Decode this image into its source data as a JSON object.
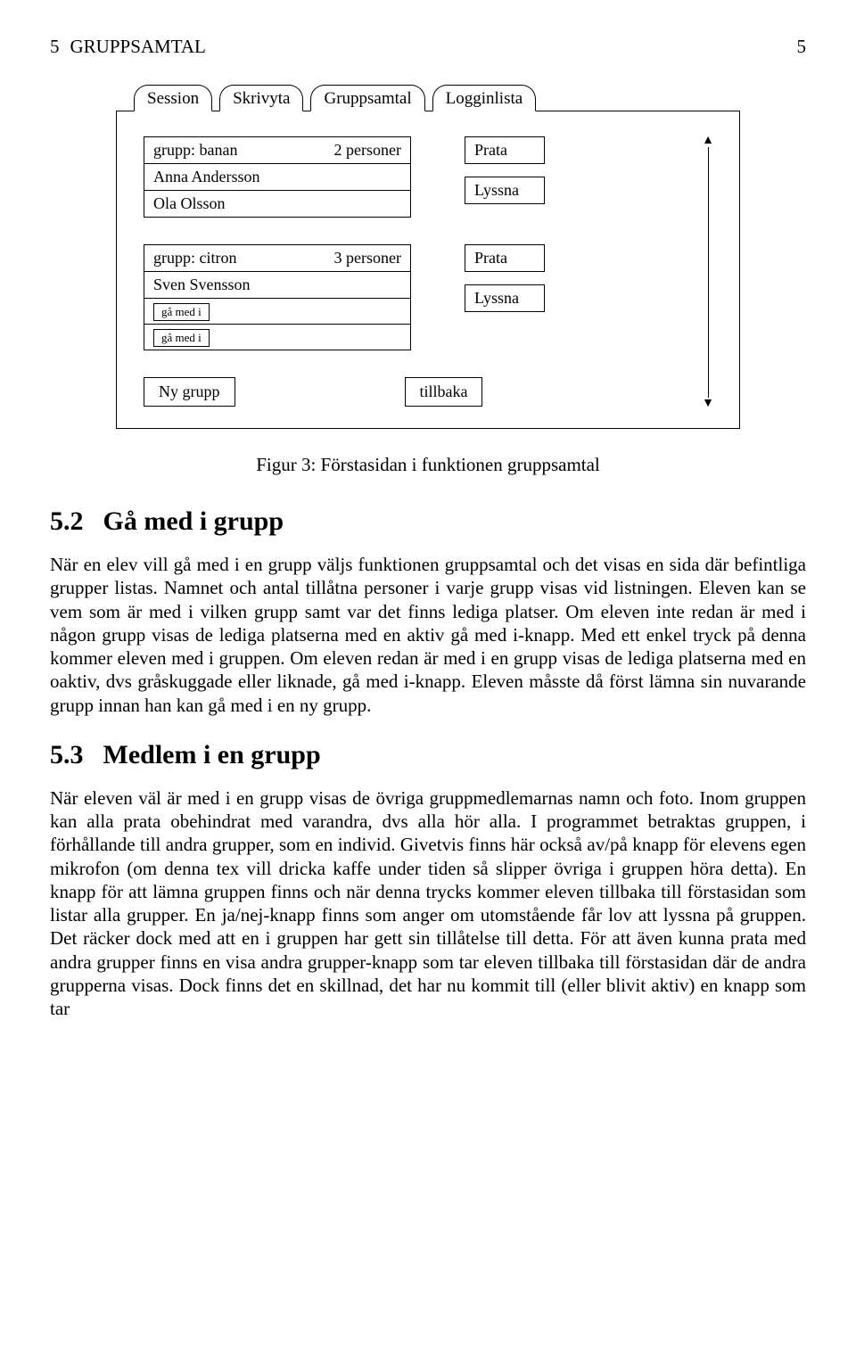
{
  "header": {
    "section_number": "5",
    "section_title": "GRUPPSAMTAL",
    "page_number": "5"
  },
  "chart_data": {
    "type": "table",
    "caption": "Figur 3: Förstasidan i funktionen gruppsamtal",
    "tabs": [
      "Session",
      "Skrivyta",
      "Gruppsamtal",
      "Logginlista"
    ],
    "groups": [
      {
        "title": "grupp: banan",
        "count": "2 personer",
        "rows": [
          "Anna Andersson",
          "Ola Olsson"
        ],
        "small_buttons": []
      },
      {
        "title": "grupp: citron",
        "count": "3 personer",
        "rows": [
          "Sven Svensson"
        ],
        "small_buttons": [
          "gå med i",
          "gå med i"
        ]
      }
    ],
    "action_buttons": [
      "Prata",
      "Lyssna"
    ],
    "bottom_buttons": [
      "Ny grupp",
      "tillbaka"
    ]
  },
  "sections": [
    {
      "number": "5.2",
      "title": "Gå med i grupp",
      "para": "När en elev vill gå med i en grupp väljs funktionen gruppsamtal och det visas en sida där befintliga grupper listas. Namnet och antal tillåtna personer i varje grupp visas vid listningen. Eleven kan se vem som är med i vilken grupp samt var det finns lediga platser. Om eleven inte redan är med i någon grupp visas de lediga platserna med en aktiv gå med i-knapp. Med ett enkel tryck på denna kommer eleven med i gruppen. Om eleven redan är med i en grupp visas de lediga platserna med en oaktiv, dvs gråskuggade eller liknade, gå med i-knapp. Eleven måsste då först lämna sin nuvarande grupp innan han kan gå med i en ny grupp."
    },
    {
      "number": "5.3",
      "title": "Medlem i en grupp",
      "para": "När eleven väl är med i en grupp visas de övriga gruppmedlemarnas namn och foto. Inom gruppen kan alla prata obehindrat med varandra, dvs alla hör alla. I programmet betraktas gruppen, i förhållande till andra grupper, som en individ. Givetvis finns här också av/på knapp för elevens egen mikrofon (om denna tex vill dricka kaffe under tiden så slipper övriga i gruppen höra detta). En knapp för att lämna gruppen finns och när denna trycks kommer eleven tillbaka till förstasidan som listar alla grupper. En ja/nej-knapp finns som anger om utomstående får lov att lyssna på gruppen. Det räcker dock med att en i gruppen har gett sin tillåtelse till detta. För att även kunna prata med andra grupper finns en visa andra grupper-knapp som tar eleven tillbaka till förstasidan där de andra grupperna visas. Dock finns det en skillnad, det har nu kommit till (eller blivit aktiv) en knapp som tar"
    }
  ]
}
